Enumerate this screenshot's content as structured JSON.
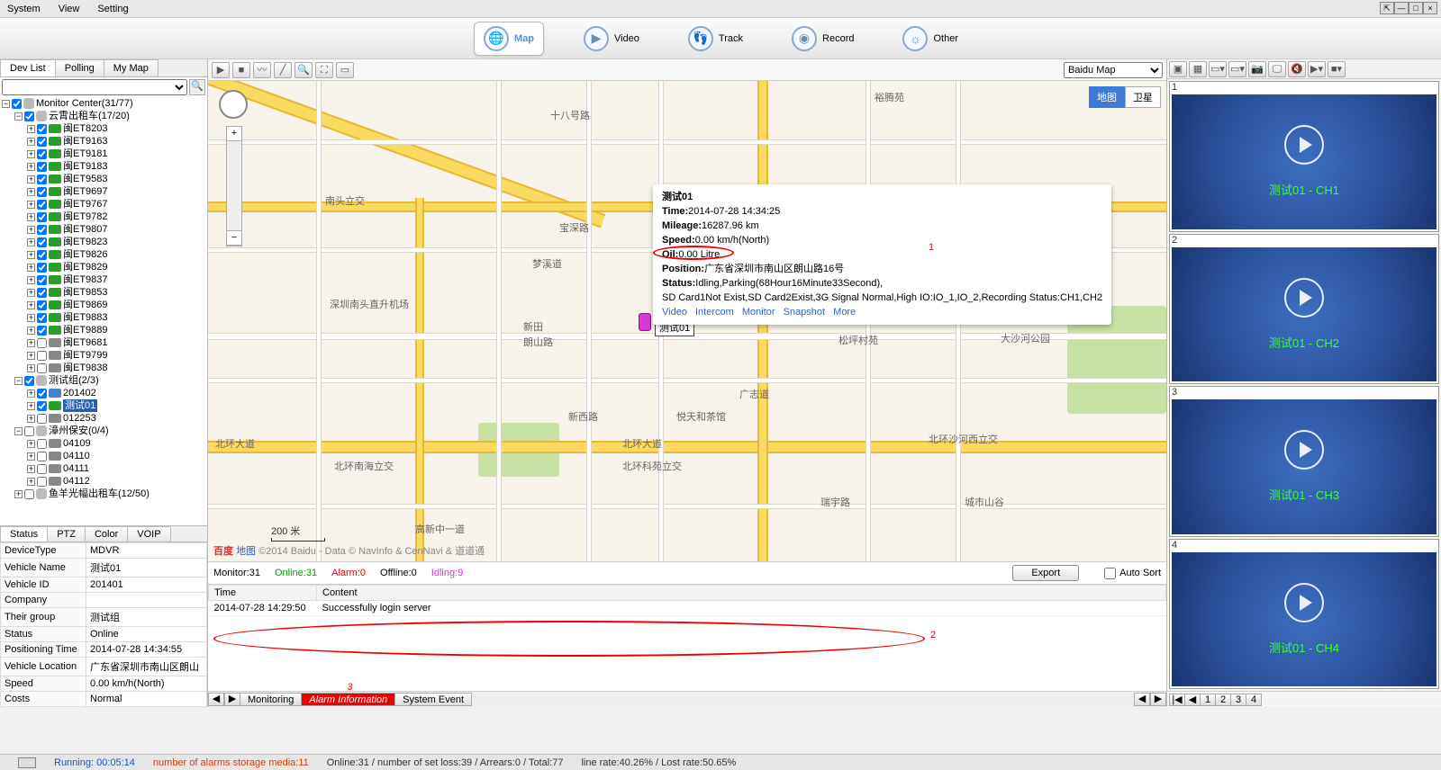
{
  "menubar": {
    "items": [
      "System",
      "View",
      "Setting"
    ]
  },
  "main_tabs": [
    {
      "icon": "🌐",
      "label": "Map",
      "active": true
    },
    {
      "icon": "▶",
      "label": "Video"
    },
    {
      "icon": "👣",
      "label": "Track"
    },
    {
      "icon": "◉",
      "label": "Record"
    },
    {
      "icon": "☼",
      "label": "Other"
    }
  ],
  "left_tabs": [
    "Dev List",
    "Polling",
    "My Map"
  ],
  "tree": {
    "root": "Monitor Center(31/77)",
    "groups": [
      {
        "name": "云霄出租车(17/20)",
        "checked": true,
        "items": [
          {
            "n": "闽ET8203",
            "c": "green",
            "chk": true
          },
          {
            "n": "闽ET9163",
            "c": "green",
            "chk": true
          },
          {
            "n": "闽ET9181",
            "c": "green",
            "chk": true
          },
          {
            "n": "闽ET9183",
            "c": "green",
            "chk": true
          },
          {
            "n": "闽ET9583",
            "c": "green",
            "chk": true
          },
          {
            "n": "闽ET9697",
            "c": "green",
            "chk": true
          },
          {
            "n": "闽ET9767",
            "c": "green",
            "chk": true
          },
          {
            "n": "闽ET9782",
            "c": "green",
            "chk": true
          },
          {
            "n": "闽ET9807",
            "c": "green",
            "chk": true
          },
          {
            "n": "闽ET9823",
            "c": "green",
            "chk": true
          },
          {
            "n": "闽ET9826",
            "c": "green",
            "chk": true
          },
          {
            "n": "闽ET9829",
            "c": "green",
            "chk": true
          },
          {
            "n": "闽ET9837",
            "c": "green",
            "chk": true
          },
          {
            "n": "闽ET9853",
            "c": "green",
            "chk": true
          },
          {
            "n": "闽ET9869",
            "c": "green",
            "chk": true
          },
          {
            "n": "闽ET9883",
            "c": "green",
            "chk": true
          },
          {
            "n": "闽ET9889",
            "c": "green",
            "chk": true
          },
          {
            "n": "闽ET9681",
            "c": "grey",
            "chk": false
          },
          {
            "n": "闽ET9799",
            "c": "grey",
            "chk": false
          },
          {
            "n": "闽ET9838",
            "c": "grey",
            "chk": false
          }
        ]
      },
      {
        "name": "测试组(2/3)",
        "checked": true,
        "items": [
          {
            "n": "201402",
            "c": "blue",
            "chk": true
          },
          {
            "n": "测试01",
            "c": "green",
            "chk": true,
            "selected": true
          },
          {
            "n": "012253",
            "c": "grey",
            "chk": false
          }
        ]
      },
      {
        "name": "漳州保安(0/4)",
        "checked": false,
        "items": [
          {
            "n": "04109",
            "c": "grey",
            "chk": false
          },
          {
            "n": "04110",
            "c": "grey",
            "chk": false
          },
          {
            "n": "04111",
            "c": "grey",
            "chk": false
          },
          {
            "n": "04112",
            "c": "grey",
            "chk": false
          }
        ]
      },
      {
        "name": "鱼羊光幅出租车(12/50)",
        "checked": false,
        "items": []
      }
    ]
  },
  "prop_tabs": [
    "Status",
    "PTZ",
    "Color",
    "VOIP"
  ],
  "props": [
    {
      "k": "DeviceType",
      "v": "MDVR"
    },
    {
      "k": "Vehicle Name",
      "v": "测试01"
    },
    {
      "k": "Vehicle ID",
      "v": "201401"
    },
    {
      "k": "Company",
      "v": ""
    },
    {
      "k": "Their group",
      "v": "测试组"
    },
    {
      "k": "Status",
      "v": "Online"
    },
    {
      "k": "Positioning Time",
      "v": "2014-07-28 14:34:55"
    },
    {
      "k": "Vehicle Location",
      "v": "广东省深圳市南山区朗山"
    },
    {
      "k": "Speed",
      "v": "0.00 km/h(North)"
    },
    {
      "k": "Costs",
      "v": "Normal"
    }
  ],
  "map": {
    "provider_label": "Baidu Map",
    "type_map": "地图",
    "type_sat": "卫星",
    "scale": "200 米",
    "copyright": "©2014 Baidu - Data © NavInfo & CenNavi & 道道通",
    "info": {
      "title": "测试01",
      "time_k": "Time:",
      "time_v": "2014-07-28 14:34:25",
      "mileage_k": "Mileage:",
      "mileage_v": "16287.96 km",
      "speed_k": "Speed:",
      "speed_v": "0.00 km/h(North)",
      "oil_k": "Oil:",
      "oil_v": "0.00 Litre",
      "position_k": "Position:",
      "position_v": "广东省深圳市南山区朗山路16号",
      "status_k": "Status:",
      "status_v": "Idling,Parking(68Hour16Minute33Second),",
      "status_line2": "SD Card1Not Exist,SD Card2Exist,3G Signal Normal,High IO:IO_1,IO_2,Recording Status:CH1,CH2",
      "links": [
        "Video",
        "Intercom",
        "Monitor",
        "Snapshot",
        "More"
      ]
    },
    "marker_label": "测试01"
  },
  "status_line": {
    "monitor_k": "Monitor:",
    "monitor_v": "31",
    "online_k": "Online:",
    "online_v": "31",
    "alarm_k": "Alarm:",
    "alarm_v": "0",
    "offline_k": "Offline:",
    "offline_v": "0",
    "idling_k": "Idling:",
    "idling_v": "9",
    "export": "Export",
    "autosort": "Auto Sort"
  },
  "events": {
    "headers": [
      "Time",
      "Content"
    ],
    "rows": [
      {
        "time": "2014-07-28 14:29:50",
        "content": "Successfully login server"
      }
    ]
  },
  "bottom_tabs": [
    "Monitoring",
    "Alarm Information",
    "System Event"
  ],
  "annotations": {
    "n1": "1",
    "n2": "2",
    "n3": "3"
  },
  "videos": [
    {
      "num": "1",
      "label": "测试01 - CH1"
    },
    {
      "num": "2",
      "label": "测试01 - CH2"
    },
    {
      "num": "3",
      "label": "测试01 - CH3"
    },
    {
      "num": "4",
      "label": "测试01 - CH4"
    }
  ],
  "right_nav": [
    "1",
    "2",
    "3",
    "4"
  ],
  "footer": {
    "running": "Running: 00:05:14",
    "alarms": "number of alarms storage media:11",
    "online": "Online:31 / number of set loss:39 / Arrears:0 / Total:77",
    "linerate": "line rate:40.26% / Lost rate:50.65%"
  }
}
